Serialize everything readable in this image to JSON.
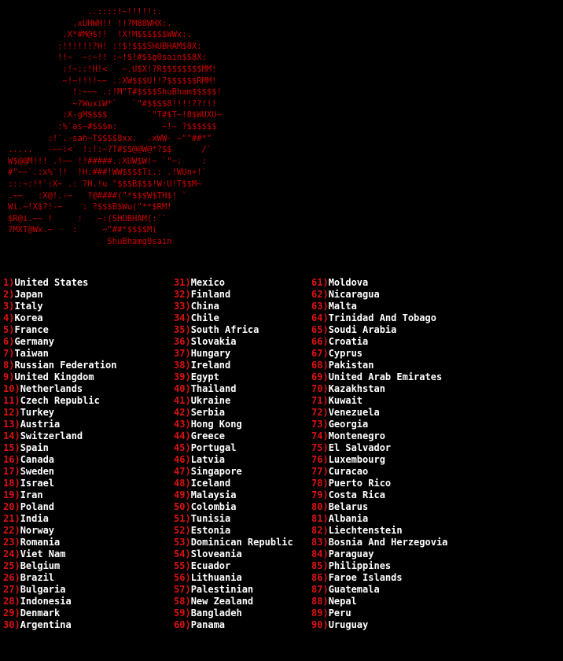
{
  "colors": {
    "background": "#000000",
    "accent_red": "#cc0000",
    "text": "#ffffff"
  },
  "ascii_art": {
    "lines": [
      "                ..::::!~!!!!!:.",
      "             .xUHWH!! !!?M88WHX:.",
      "           .X*#M@$!!  !X!M$$$$$$WWx:.",
      "          :!!!!!!?H! :!$!$$$SHUBHAM$8X:",
      "          !!~  ~:~!! :~!$!#$$g0sain$$8X:",
      "           :!~::!H!<   ~.U$X!?R$$$$$$$$MM!",
      "           ~!~!!!!~~ .:XW$$$U!!?$$$$$$RMM!",
      "             !:~~~ .:!M\"T#$$$$ShuBham$$$$$!",
      "             ~?WuxiW*`   `\"#$$$$8!!!!??!!!",
      "           :X-gM$$$$        `\"T#$T~!8$WUXU~",
      "          :%`as~#$$$m:         ~!~ ?$$$$$$",
      "        :!`.-sah~T$$$$8xx.  .xWW- ~\"\"##*\"",
      ".....   -~~:<` !:!:~?T#$$@@W@*?$$      /`",
      "W$@@M!!! .!~~ !!#####.:XUW$W!~ `\"~:    :",
      "#\"~~`.:x%`!!  !H:###!WW$$$$Ti.: .!WUn+!`",
      ":::~:!!`:X~ .: ?H.!u \"$$$B$$$!W:U!T$$M~",
      ".~~   :X@!.-~   ?@####(\"*$$$W$TH$! `",
      "Wi.~!X$?!-~    : ?$$$B$Wu(\"**$RM!",
      "$R@i.~~ !     :   ~:(SHUBHAM(:``",
      "?MXT@Wx.~    :     ~\"##*$$$$M(",
      "                    ShuBhamg0sain"
    ]
  },
  "countries": [
    {
      "index": "1)",
      "name": "United States"
    },
    {
      "index": "2)",
      "name": "Japan"
    },
    {
      "index": "3)",
      "name": "Italy"
    },
    {
      "index": "4)",
      "name": "Korea"
    },
    {
      "index": "5)",
      "name": "France"
    },
    {
      "index": "6)",
      "name": "Germany"
    },
    {
      "index": "7)",
      "name": "Taiwan"
    },
    {
      "index": "8)",
      "name": "Russian Federation"
    },
    {
      "index": "9)",
      "name": "United Kingdom"
    },
    {
      "index": "10)",
      "name": "Netherlands"
    },
    {
      "index": "11)",
      "name": "Czech Republic"
    },
    {
      "index": "12)",
      "name": "Turkey"
    },
    {
      "index": "13)",
      "name": "Austria"
    },
    {
      "index": "14)",
      "name": "Switzerland"
    },
    {
      "index": "15)",
      "name": "Spain"
    },
    {
      "index": "16)",
      "name": "Canada"
    },
    {
      "index": "17)",
      "name": "Sweden"
    },
    {
      "index": "18)",
      "name": "Israel"
    },
    {
      "index": "19)",
      "name": "Iran"
    },
    {
      "index": "20)",
      "name": "Poland"
    },
    {
      "index": "21)",
      "name": "India"
    },
    {
      "index": "22)",
      "name": "Norway"
    },
    {
      "index": "23)",
      "name": "Romania"
    },
    {
      "index": "24)",
      "name": "Viet Nam"
    },
    {
      "index": "25)",
      "name": "Belgium"
    },
    {
      "index": "26)",
      "name": "Brazil"
    },
    {
      "index": "27)",
      "name": "Bulgaria"
    },
    {
      "index": "28)",
      "name": "Indonesia"
    },
    {
      "index": "29)",
      "name": "Denmark"
    },
    {
      "index": "30)",
      "name": "Argentina"
    },
    {
      "index": "31)",
      "name": "Mexico"
    },
    {
      "index": "32)",
      "name": "Finland"
    },
    {
      "index": "33)",
      "name": "China"
    },
    {
      "index": "34)",
      "name": "Chile"
    },
    {
      "index": "35)",
      "name": "South Africa"
    },
    {
      "index": "36)",
      "name": "Slovakia"
    },
    {
      "index": "37)",
      "name": "Hungary"
    },
    {
      "index": "38)",
      "name": "Ireland"
    },
    {
      "index": "39)",
      "name": "Egypt"
    },
    {
      "index": "40)",
      "name": "Thailand"
    },
    {
      "index": "41)",
      "name": "Ukraine"
    },
    {
      "index": "42)",
      "name": "Serbia"
    },
    {
      "index": "43)",
      "name": "Hong Kong"
    },
    {
      "index": "44)",
      "name": "Greece"
    },
    {
      "index": "45)",
      "name": "Portugal"
    },
    {
      "index": "46)",
      "name": "Latvia"
    },
    {
      "index": "47)",
      "name": "Singapore"
    },
    {
      "index": "48)",
      "name": "Iceland"
    },
    {
      "index": "49)",
      "name": "Malaysia"
    },
    {
      "index": "50)",
      "name": "Colombia"
    },
    {
      "index": "51)",
      "name": "Tunisia"
    },
    {
      "index": "52)",
      "name": "Estonia"
    },
    {
      "index": "53)",
      "name": "Dominican Republic"
    },
    {
      "index": "54)",
      "name": "Sloveania"
    },
    {
      "index": "55)",
      "name": "Ecuador"
    },
    {
      "index": "56)",
      "name": "Lithuania"
    },
    {
      "index": "57)",
      "name": "Palestinian"
    },
    {
      "index": "58)",
      "name": "New Zealand"
    },
    {
      "index": "59)",
      "name": "Bangladeh"
    },
    {
      "index": "60)",
      "name": "Panama"
    },
    {
      "index": "61)",
      "name": "Moldova"
    },
    {
      "index": "62)",
      "name": "Nicaragua"
    },
    {
      "index": "63)",
      "name": "Malta"
    },
    {
      "index": "64)",
      "name": "Trinidad And Tobago"
    },
    {
      "index": "65)",
      "name": "Soudi Arabia"
    },
    {
      "index": "66)",
      "name": "Croatia"
    },
    {
      "index": "67)",
      "name": "Cyprus"
    },
    {
      "index": "68)",
      "name": "Pakistan"
    },
    {
      "index": "69)",
      "name": "United Arab Emirates"
    },
    {
      "index": "70)",
      "name": "Kazakhstan"
    },
    {
      "index": "71)",
      "name": "Kuwait"
    },
    {
      "index": "72)",
      "name": "Venezuela"
    },
    {
      "index": "73)",
      "name": "Georgia"
    },
    {
      "index": "74)",
      "name": "Montenegro"
    },
    {
      "index": "75)",
      "name": "El Salvador"
    },
    {
      "index": "76)",
      "name": "Luxembourg"
    },
    {
      "index": "77)",
      "name": "Curacao"
    },
    {
      "index": "78)",
      "name": "Puerto Rico"
    },
    {
      "index": "79)",
      "name": "Costa Rica"
    },
    {
      "index": "80)",
      "name": "Belarus"
    },
    {
      "index": "81)",
      "name": "Albania"
    },
    {
      "index": "82)",
      "name": "Liechtenstein"
    },
    {
      "index": "83)",
      "name": "Bosnia And Herzegovia"
    },
    {
      "index": "84)",
      "name": "Paraguay"
    },
    {
      "index": "85)",
      "name": "Philippines"
    },
    {
      "index": "86)",
      "name": "Faroe Islands"
    },
    {
      "index": "87)",
      "name": "Guatemala"
    },
    {
      "index": "88)",
      "name": "Nepal"
    },
    {
      "index": "89)",
      "name": "Peru"
    },
    {
      "index": "90)",
      "name": "Uruguay"
    }
  ]
}
